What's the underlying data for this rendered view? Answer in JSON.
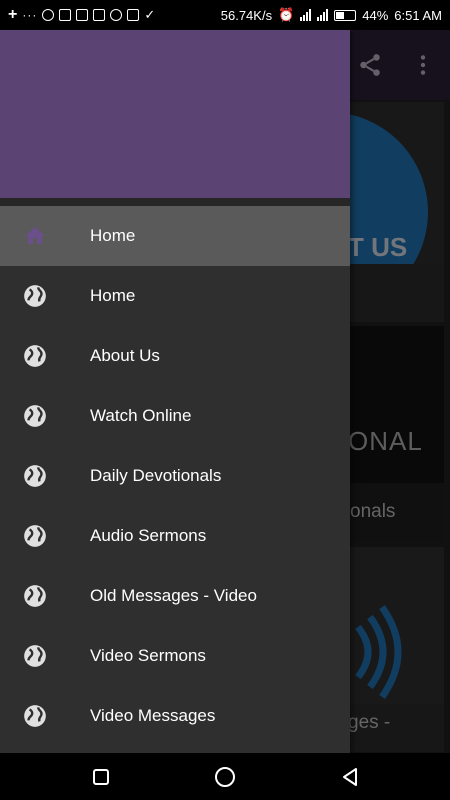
{
  "status_bar": {
    "speed": "56.74K/s",
    "battery_pct": "44%",
    "time": "6:51 AM",
    "notification_icons": [
      "plus-icon",
      "more-dots-icon",
      "whatsapp-icon",
      "gmail-icon",
      "youtube-icon",
      "messages-icon",
      "football-icon",
      "instagram-icon",
      "download-done-icon"
    ]
  },
  "background": {
    "card1_label": "T US",
    "card2_big": "ONAL",
    "card2_label": "onals",
    "card3_label": "ges -"
  },
  "drawer": {
    "header_color": "#5b4474",
    "items": [
      {
        "label": "Home",
        "icon": "home-icon",
        "active": true
      },
      {
        "label": "Home",
        "icon": "globe-icon",
        "active": false
      },
      {
        "label": "About Us",
        "icon": "globe-icon",
        "active": false
      },
      {
        "label": "Watch Online",
        "icon": "globe-icon",
        "active": false
      },
      {
        "label": "Daily Devotionals",
        "icon": "globe-icon",
        "active": false
      },
      {
        "label": "Audio Sermons",
        "icon": "globe-icon",
        "active": false
      },
      {
        "label": "Old Messages - Video",
        "icon": "globe-icon",
        "active": false
      },
      {
        "label": "Video Sermons",
        "icon": "globe-icon",
        "active": false
      },
      {
        "label": "Video Messages",
        "icon": "globe-icon",
        "active": false
      }
    ]
  },
  "colors": {
    "accent": "#5b4474",
    "active_item_bg": "#5a5a5a",
    "drawer_bg": "#2f2f2f"
  }
}
